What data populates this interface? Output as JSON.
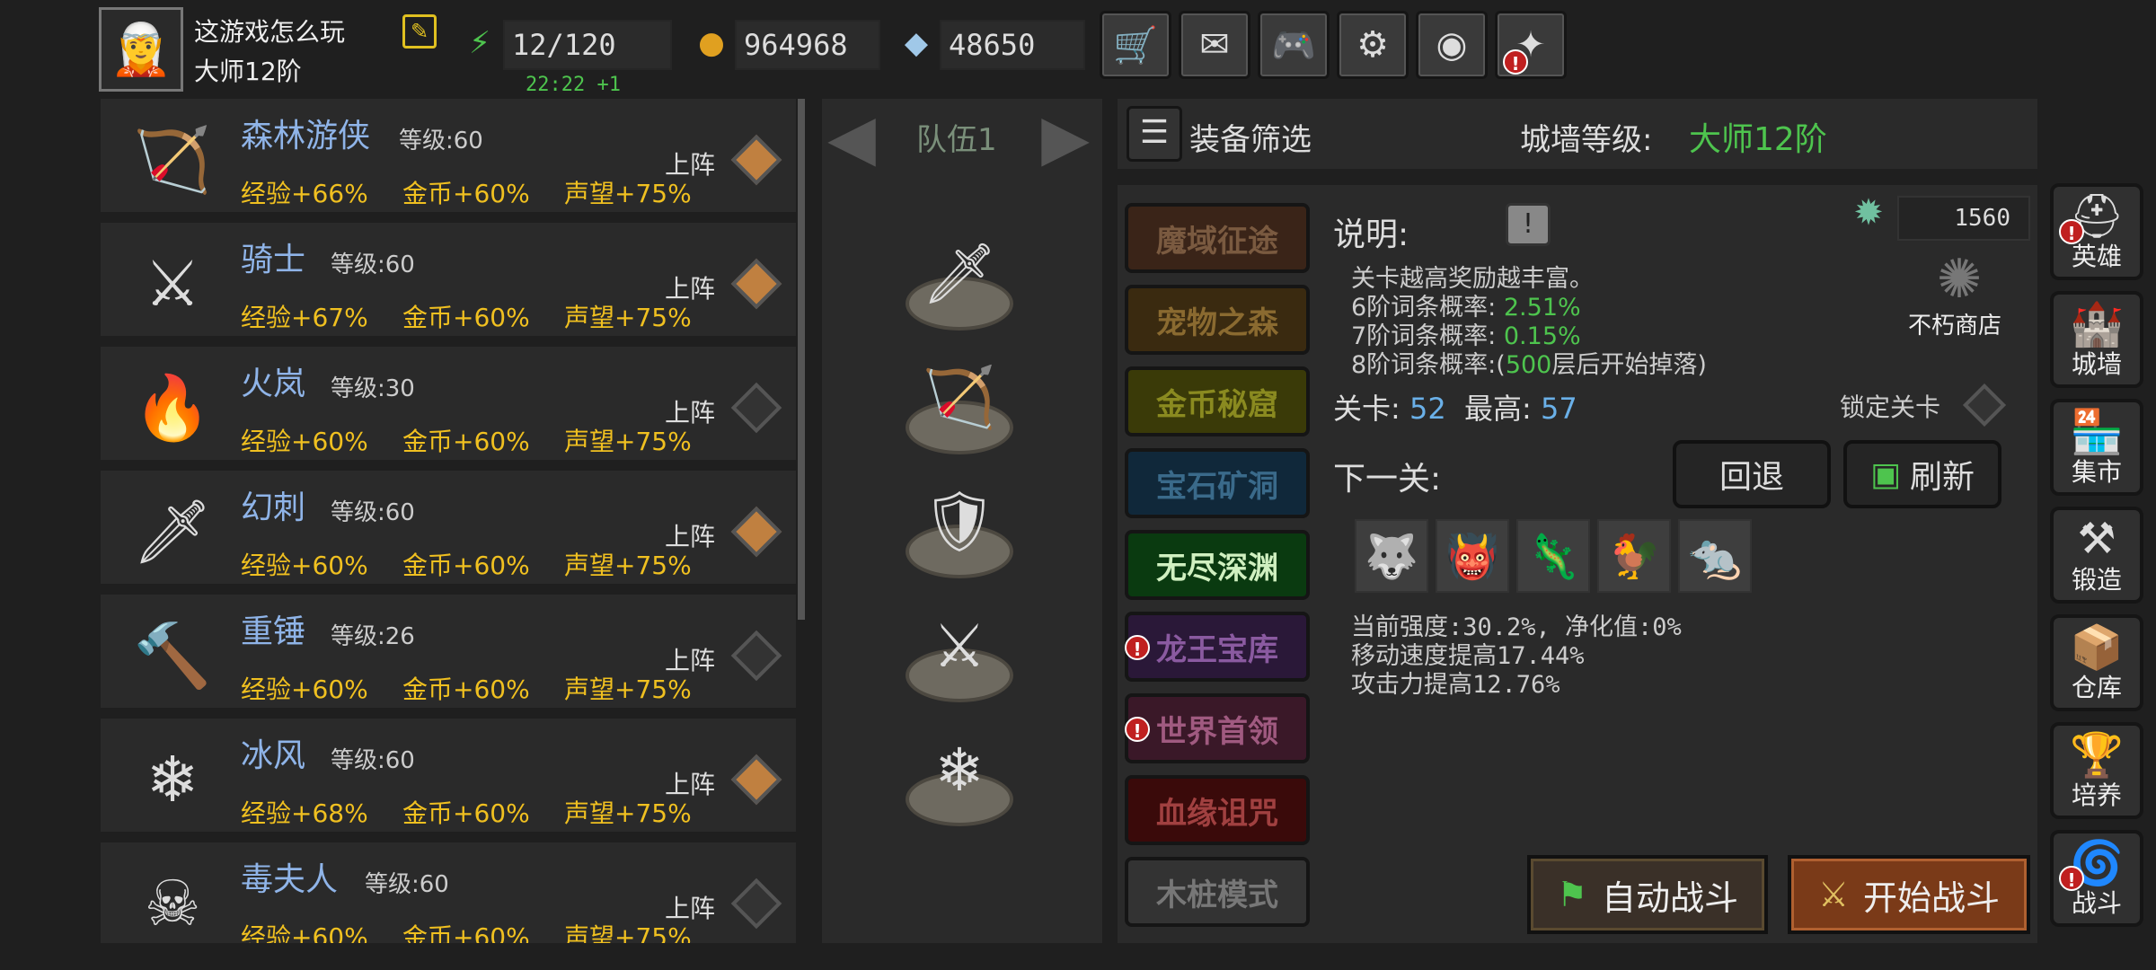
{
  "player": {
    "name": "这游戏怎么玩",
    "rank": "大师12阶",
    "avatar_icon": "elf-archer-portrait-icon"
  },
  "resources": {
    "energy": "12/120",
    "timer": "22:22 +1",
    "gold": "964968",
    "gems": "48650"
  },
  "toolbar": [
    "cart-icon",
    "mail-icon",
    "gamepad-icon",
    "gear-icon",
    "color-wheel-icon",
    "firework-icon"
  ],
  "heroes": [
    {
      "name": "森林游侠",
      "level": "等级:60",
      "exp": "经验+66%",
      "gold": "金币+60%",
      "fame": "声望+75%",
      "deploy": "上阵",
      "deployed": true,
      "icon": "ranger-sprite",
      "glyph": "🏹"
    },
    {
      "name": "骑士",
      "level": "等级:60",
      "exp": "经验+67%",
      "gold": "金币+60%",
      "fame": "声望+75%",
      "deploy": "上阵",
      "deployed": true,
      "icon": "knight-sprite",
      "glyph": "⚔"
    },
    {
      "name": "火岚",
      "level": "等级:30",
      "exp": "经验+60%",
      "gold": "金币+60%",
      "fame": "声望+75%",
      "deploy": "上阵",
      "deployed": false,
      "icon": "mage-sprite",
      "glyph": "🔥"
    },
    {
      "name": "幻刺",
      "level": "等级:60",
      "exp": "经验+60%",
      "gold": "金币+60%",
      "fame": "声望+75%",
      "deploy": "上阵",
      "deployed": true,
      "icon": "assassin-sprite",
      "glyph": "🗡"
    },
    {
      "name": "重锤",
      "level": "等级:26",
      "exp": "经验+60%",
      "gold": "金币+60%",
      "fame": "声望+75%",
      "deploy": "上阵",
      "deployed": false,
      "icon": "hammer-sprite",
      "glyph": "🔨"
    },
    {
      "name": "冰风",
      "level": "等级:60",
      "exp": "经验+68%",
      "gold": "金币+60%",
      "fame": "声望+75%",
      "deploy": "上阵",
      "deployed": true,
      "icon": "ice-mage-sprite",
      "glyph": "❄"
    },
    {
      "name": "毒夫人",
      "level": "等级:60",
      "exp": "经验+60%",
      "gold": "金币+60%",
      "fame": "声望+75%",
      "deploy": "上阵",
      "deployed": false,
      "icon": "poison-lady-sprite",
      "glyph": "☠"
    }
  ],
  "team": {
    "title": "队伍1",
    "members": [
      "🗡",
      "🏹",
      "🛡",
      "⚔",
      "❄"
    ]
  },
  "filter": {
    "label": "装备筛选"
  },
  "wall": {
    "label": "城墙等级:",
    "value": "大师12阶"
  },
  "modes": [
    {
      "label": "魔域征途",
      "bg": "#3a2418",
      "fg": "#7a5a40",
      "alert": false
    },
    {
      "label": "宠物之森",
      "bg": "#3a2a10",
      "fg": "#8a6a30",
      "alert": false
    },
    {
      "label": "金币秘窟",
      "bg": "#3a3a08",
      "fg": "#8a8a20",
      "alert": false
    },
    {
      "label": "宝石矿洞",
      "bg": "#10283a",
      "fg": "#3a6a8a",
      "alert": false
    },
    {
      "label": "无尽深渊",
      "bg": "#0a3a10",
      "fg": "#d0f0c0",
      "alert": false
    },
    {
      "label": "龙王宝库",
      "bg": "#2a1838",
      "fg": "#8a5aa0",
      "alert": true
    },
    {
      "label": "世界首领",
      "bg": "#3a1828",
      "fg": "#a05a80",
      "alert": true
    },
    {
      "label": "血缘诅咒",
      "bg": "#3a0a0a",
      "fg": "#a04040",
      "alert": false
    },
    {
      "label": "木桩模式",
      "bg": "#333333",
      "fg": "#777777",
      "alert": false
    }
  ],
  "desc": {
    "title": "说明:",
    "line1": "关卡越高奖励越丰富。",
    "r6_label": "6阶词条概率:",
    "r6": "2.51%",
    "r7_label": "7阶词条概率:",
    "r7": "0.15%",
    "r8_label": "8阶词条概率:(",
    "r8_num": "500",
    "r8_tail": "层后开始掉落)"
  },
  "crystal_count": "1560",
  "shop_label": "不朽商店",
  "stage": {
    "label": "关卡:",
    "value": "52",
    "best_label": "最高:",
    "best": "57",
    "lock": "锁定关卡"
  },
  "next": {
    "label": "下一关:",
    "retreat": "回退",
    "refresh": "刷新",
    "enemies": [
      "🐺",
      "👹",
      "🦎",
      "🐓",
      "🐀"
    ]
  },
  "stats": [
    "当前强度:30.2%, 净化值:0%",
    "移动速度提高17.44%",
    "攻击力提高12.76%"
  ],
  "actions": {
    "auto": "自动战斗",
    "start": "开始战斗"
  },
  "nav": [
    {
      "label": "英雄",
      "icon": "helmet-icon",
      "glyph": "⛑",
      "alert": true
    },
    {
      "label": "城墙",
      "icon": "castle-icon",
      "glyph": "🏰",
      "alert": false
    },
    {
      "label": "集市",
      "icon": "market-icon",
      "glyph": "🏪",
      "alert": false
    },
    {
      "label": "锻造",
      "icon": "anvil-icon",
      "glyph": "⚒",
      "alert": false
    },
    {
      "label": "仓库",
      "icon": "chest-icon",
      "glyph": "📦",
      "alert": false
    },
    {
      "label": "培养",
      "icon": "goblet-icon",
      "glyph": "🏆",
      "alert": false
    },
    {
      "label": "战斗",
      "icon": "portal-icon",
      "glyph": "🌀",
      "alert": true
    }
  ]
}
